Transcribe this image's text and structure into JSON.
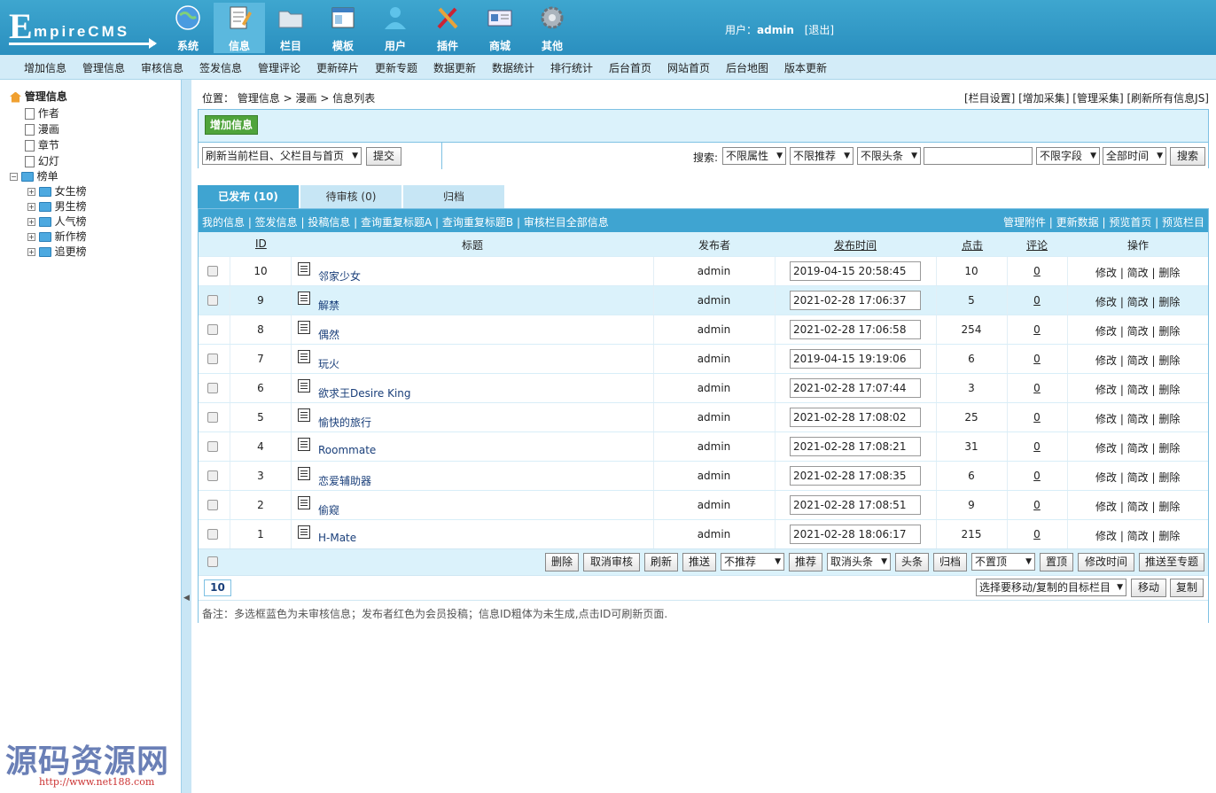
{
  "logo": {
    "initial": "E",
    "rest": "mpireCMS"
  },
  "nav": [
    {
      "label": "系统",
      "icon": "globe-icon",
      "active": false
    },
    {
      "label": "信息",
      "icon": "notepad-icon",
      "active": true
    },
    {
      "label": "栏目",
      "icon": "folder-icon",
      "active": false
    },
    {
      "label": "模板",
      "icon": "window-icon",
      "active": false
    },
    {
      "label": "用户",
      "icon": "user-icon",
      "active": false
    },
    {
      "label": "插件",
      "icon": "tools-icon",
      "active": false
    },
    {
      "label": "商城",
      "icon": "card-icon",
      "active": false
    },
    {
      "label": "其他",
      "icon": "gear-icon",
      "active": false
    }
  ],
  "user": {
    "prefix": "用户：",
    "name": "admin",
    "logout": "[退出]"
  },
  "menu": [
    "增加信息",
    "管理信息",
    "审核信息",
    "签发信息",
    "管理评论",
    "更新碎片",
    "更新专题",
    "数据更新",
    "数据统计",
    "排行统计",
    "后台首页",
    "网站首页",
    "后台地图",
    "版本更新"
  ],
  "tree": {
    "root": "管理信息",
    "items": [
      "作者",
      "漫画",
      "章节",
      "幻灯"
    ],
    "group": "榜单",
    "children": [
      "女生榜",
      "男生榜",
      "人气榜",
      "新作榜",
      "追更榜"
    ]
  },
  "watermark": {
    "text": "源码资源网",
    "url": "http://www.net188.com"
  },
  "breadcrumb": {
    "prefix": "位置：",
    "path": "管理信息 > 漫画 > 信息列表"
  },
  "toplinks": "[栏目设置] [增加采集] [管理采集] [刷新所有信息JS]",
  "toolbar": {
    "add": "增加信息",
    "refresh_select": "刷新当前栏目、父栏目与首页",
    "submit": "提交",
    "search_label": "搜索:",
    "attr": "不限属性",
    "recommend": "不限推荐",
    "headline": "不限头条",
    "search_value": "",
    "field": "不限字段",
    "time": "全部时间",
    "search_btn": "搜索"
  },
  "tabs": [
    "已发布 (10)",
    "待审核 (0)",
    "归档"
  ],
  "linkrow": {
    "left": "我的信息 | 签发信息 | 投稿信息 | 查询重复标题A | 查询重复标题B | 审核栏目全部信息",
    "right": "管理附件 | 更新数据 | 预览首页 | 预览栏目"
  },
  "columns": [
    "ID",
    "标题",
    "发布者",
    "发布时间",
    "点击",
    "评论",
    "操作"
  ],
  "rows": [
    {
      "id": "10",
      "title": "邻家少女",
      "author": "admin",
      "time": "2019-04-15 20:58:45",
      "hits": "10",
      "comments": "0",
      "ops": "修改 | 简改 | 删除"
    },
    {
      "id": "9",
      "title": "解禁",
      "author": "admin",
      "time": "2021-02-28 17:06:37",
      "hits": "5",
      "comments": "0",
      "ops": "修改 | 简改 | 删除"
    },
    {
      "id": "8",
      "title": "偶然",
      "author": "admin",
      "time": "2021-02-28 17:06:58",
      "hits": "254",
      "comments": "0",
      "ops": "修改 | 简改 | 删除"
    },
    {
      "id": "7",
      "title": "玩火",
      "author": "admin",
      "time": "2019-04-15 19:19:06",
      "hits": "6",
      "comments": "0",
      "ops": "修改 | 简改 | 删除"
    },
    {
      "id": "6",
      "title": "欲求王Desire King",
      "author": "admin",
      "time": "2021-02-28 17:07:44",
      "hits": "3",
      "comments": "0",
      "ops": "修改 | 简改 | 删除"
    },
    {
      "id": "5",
      "title": "愉快的旅行",
      "author": "admin",
      "time": "2021-02-28 17:08:02",
      "hits": "25",
      "comments": "0",
      "ops": "修改 | 简改 | 删除"
    },
    {
      "id": "4",
      "title": "Roommate",
      "author": "admin",
      "time": "2021-02-28 17:08:21",
      "hits": "31",
      "comments": "0",
      "ops": "修改 | 简改 | 删除"
    },
    {
      "id": "3",
      "title": "恋爱辅助器",
      "author": "admin",
      "time": "2021-02-28 17:08:35",
      "hits": "6",
      "comments": "0",
      "ops": "修改 | 简改 | 删除"
    },
    {
      "id": "2",
      "title": "偷窥",
      "author": "admin",
      "time": "2021-02-28 17:08:51",
      "hits": "9",
      "comments": "0",
      "ops": "修改 | 简改 | 删除"
    },
    {
      "id": "1",
      "title": "H-Mate",
      "author": "admin",
      "time": "2021-02-28 18:06:17",
      "hits": "215",
      "comments": "0",
      "ops": "修改 | 简改 | 删除"
    }
  ],
  "actions": {
    "delete": "删除",
    "unaudit": "取消审核",
    "refresh": "刷新",
    "push": "推送",
    "notrec": "不推荐",
    "recommend": "推荐",
    "cancelhead": "取消头条",
    "headline": "头条",
    "archive": "归档",
    "nottop": "不置顶",
    "top": "置顶",
    "edittime": "修改时间",
    "tospecial": "推送至专题"
  },
  "pager": {
    "num": "10",
    "target": "选择要移动/复制的目标栏目",
    "move": "移动",
    "copy": "复制"
  },
  "note": "备注：多选框蓝色为未审核信息；发布者红色为会员投稿；信息ID粗体为未生成,点击ID可刷新页面.",
  "colors": {
    "accent": "#3fa4d1",
    "light": "#dbf2fb",
    "add_button": "#4fa43b"
  }
}
